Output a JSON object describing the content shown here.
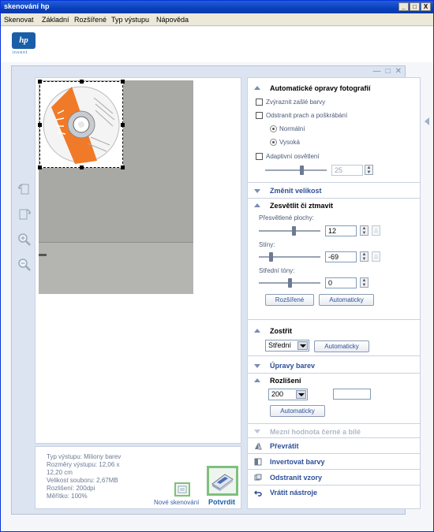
{
  "window": {
    "title": "skenování hp",
    "controls": [
      "_",
      "□",
      "X"
    ]
  },
  "menu": [
    "Skenovat",
    "Základní",
    "Rozšířené",
    "Typ výstupu",
    "Nápověda"
  ],
  "logo": {
    "text": "hp",
    "tagline": "invent"
  },
  "frame_controls": [
    "—",
    "□",
    "✕"
  ],
  "info": {
    "lines": [
      "Typ výstupu: Miliony barev",
      "Rozměry výstupu: 12,06 x",
      "12,20 cm",
      "Velikost souboru: 2,67MB",
      "Rozlišení:  200dpi",
      "Měřítko: 100%"
    ],
    "new_scan": "Nové skenování",
    "confirm": "Potvrdit"
  },
  "panel": {
    "auto_fix": {
      "title": "Automatické opravy fotografií",
      "fade": "Zvýraznit zašlé barvy",
      "dust": "Odstranit prach a poškrábání",
      "normal": "Normální",
      "high": "Vysoká",
      "adaptive": "Adaptivní osvětlení",
      "adaptive_value": "25",
      "adaptive_level": 0.6
    },
    "resize": {
      "title": "Změnit velikost"
    },
    "lighten": {
      "title": "Zesvětlit či ztmavit",
      "highlights_label": "Přesvětlené plochy:",
      "highlights_value": "12",
      "highlights_level": 0.58,
      "shadows_label": "Stíny:",
      "shadows_value": "-69",
      "shadows_level": 0.18,
      "midtones_label": "Střední tóny:",
      "midtones_value": "0",
      "midtones_level": 0.5,
      "advanced_btn": "Rozšířené",
      "auto_btn": "Automaticky"
    },
    "sharpen": {
      "title": "Zostřit",
      "value": "Střední",
      "auto_btn": "Automaticky"
    },
    "color": {
      "title": "Úpravy barev"
    },
    "resolution": {
      "title": "Rozlišení",
      "value": "200",
      "custom_value": "",
      "auto_btn": "Automaticky"
    },
    "threshold": {
      "title": "Mezní hodnota černé a bílé"
    },
    "actions": [
      "Převrátit",
      "Invertovat barvy",
      "Odstranit vzory",
      "Vrátit nástroje"
    ]
  },
  "colors": {
    "accent": "#2d4f9a",
    "title_bar": "#0a3fbd",
    "green_frame": "#7ec07e",
    "disc_orange": "#f07a28"
  }
}
